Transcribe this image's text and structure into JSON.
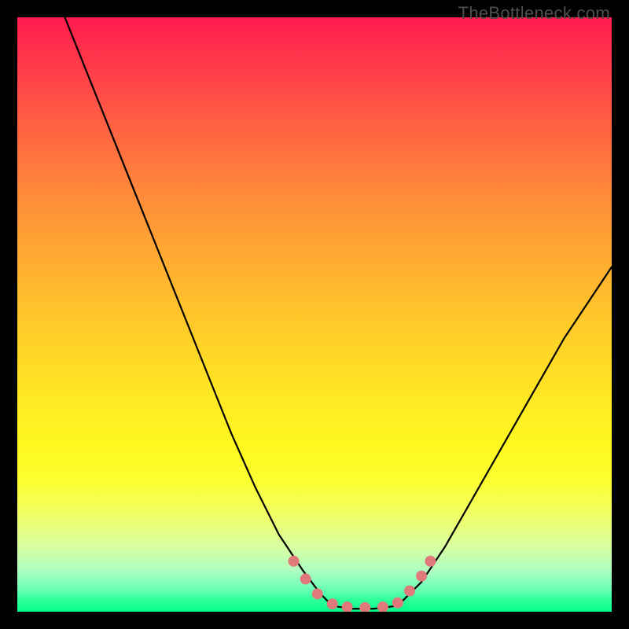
{
  "watermark": "TheBottleneck.com",
  "chart_data": {
    "type": "line",
    "title": "",
    "xlabel": "",
    "ylabel": "",
    "xlim": [
      0,
      100
    ],
    "ylim": [
      0,
      100
    ],
    "grid": false,
    "legend": false,
    "background": {
      "kind": "vertical-gradient",
      "stops": [
        {
          "pos": 0.0,
          "color": "#ff1a4d"
        },
        {
          "pos": 0.5,
          "color": "#ffd028"
        },
        {
          "pos": 0.8,
          "color": "#f0ff6a"
        },
        {
          "pos": 1.0,
          "color": "#00ff8a"
        }
      ]
    },
    "series": [
      {
        "name": "left-curve",
        "color": "#000000",
        "x": [
          8,
          12,
          16,
          20,
          24,
          28,
          32,
          36,
          40,
          44,
          48,
          51,
          53
        ],
        "y": [
          100,
          90,
          80,
          70,
          60,
          50,
          40,
          30,
          21,
          13,
          7,
          3,
          1
        ]
      },
      {
        "name": "flat-bottom",
        "color": "#000000",
        "x": [
          53,
          56,
          60,
          64
        ],
        "y": [
          1,
          0.5,
          0.5,
          1
        ]
      },
      {
        "name": "right-curve",
        "color": "#000000",
        "x": [
          64,
          68,
          72,
          76,
          80,
          84,
          88,
          92,
          96,
          100
        ],
        "y": [
          1,
          5,
          11,
          18,
          25,
          32,
          39,
          46,
          52,
          58
        ]
      }
    ],
    "markers": {
      "name": "highlight-dots",
      "color": "#e07a7a",
      "points": [
        {
          "x": 46.5,
          "y": 8.5
        },
        {
          "x": 48.5,
          "y": 5.5
        },
        {
          "x": 50.5,
          "y": 3.0
        },
        {
          "x": 53.0,
          "y": 1.3
        },
        {
          "x": 55.5,
          "y": 0.8
        },
        {
          "x": 58.5,
          "y": 0.7
        },
        {
          "x": 61.5,
          "y": 0.8
        },
        {
          "x": 64.0,
          "y": 1.5
        },
        {
          "x": 66.0,
          "y": 3.5
        },
        {
          "x": 68.0,
          "y": 6.0
        },
        {
          "x": 69.5,
          "y": 8.5
        }
      ]
    }
  }
}
